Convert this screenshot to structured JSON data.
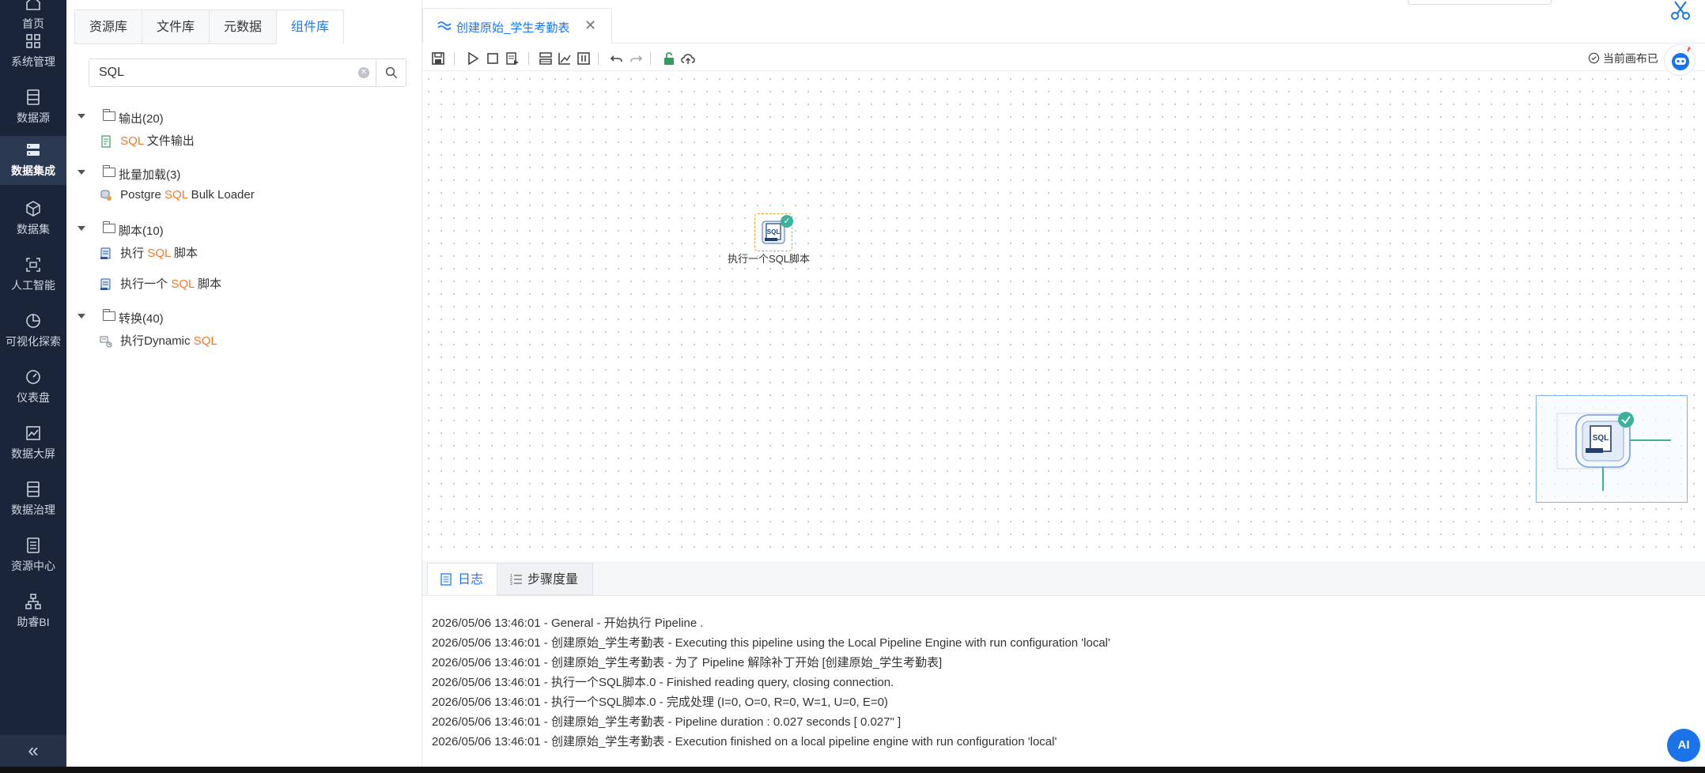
{
  "nav": {
    "items": [
      {
        "label": "首页",
        "icon": "home-icon"
      },
      {
        "label": "系统管理",
        "icon": "grid-icon"
      },
      {
        "label": "数据源",
        "icon": "database-icon"
      },
      {
        "label": "数据集成",
        "icon": "server-stack-icon"
      },
      {
        "label": "数据集",
        "icon": "cube-icon"
      },
      {
        "label": "人工智能",
        "icon": "ai-scan-icon"
      },
      {
        "label": "可视化探索",
        "icon": "pie-icon"
      },
      {
        "label": "仪表盘",
        "icon": "gauge-icon"
      },
      {
        "label": "数据大屏",
        "icon": "line-chart-icon"
      },
      {
        "label": "数据治理",
        "icon": "list-box-icon"
      },
      {
        "label": "资源中心",
        "icon": "book-icon"
      },
      {
        "label": "助睿BI",
        "icon": "org-tree-icon"
      }
    ],
    "active_index": 3,
    "collapse_glyph": "«"
  },
  "panel": {
    "tabs": [
      "资源库",
      "文件库",
      "元数据",
      "组件库"
    ],
    "active_tab": 3,
    "search": {
      "value": "SQL"
    },
    "tree": {
      "group1": {
        "label": "输出(20)"
      },
      "leaf1": {
        "pre": "",
        "hl": "SQL",
        "post": " 文件输出"
      },
      "group2": {
        "label": "批量加载(3)"
      },
      "leaf2": {
        "pre": "Postgre ",
        "hl": "SQL",
        "post": " Bulk Loader"
      },
      "group3": {
        "label": "脚本(10)"
      },
      "leaf3": {
        "pre": "执行 ",
        "hl": "SQL",
        "post": " 脚本"
      },
      "leaf4": {
        "pre": "执行一个 ",
        "hl": "SQL",
        "post": " 脚本"
      },
      "group4": {
        "label": "转换(40)"
      },
      "leaf5": {
        "pre": "执行Dynamic ",
        "hl": "SQL",
        "post": ""
      }
    }
  },
  "doc": {
    "tab_title": "创建原始_学生考勤表",
    "close_glyph": "✕"
  },
  "toolbar": {
    "right_label": "当前画布已"
  },
  "canvas": {
    "step_label": "执行一个SQL脚本",
    "step_icon_text": "SQL",
    "minimap_icon_text": "SQL"
  },
  "log": {
    "tabs": [
      "日志",
      "步骤度量"
    ],
    "lines": [
      "2026/05/06 13:46:01 - General - 开始执行 Pipeline .",
      "2026/05/06 13:46:01 - 创建原始_学生考勤表 - Executing this pipeline using the Local Pipeline Engine with run configuration 'local'",
      "2026/05/06 13:46:01 - 创建原始_学生考勤表 - 为了 Pipeline 解除补丁开始 [创建原始_学生考勤表]",
      "2026/05/06 13:46:01 - 执行一个SQL脚本.0 - Finished reading query, closing connection.",
      "2026/05/06 13:46:01 - 执行一个SQL脚本.0 - 完成处理 (I=0, O=0, R=0, W=1, U=0, E=0)",
      "2026/05/06 13:46:01 - 创建原始_学生考勤表 - Pipeline duration : 0.027 seconds [  0.027\" ]",
      "2026/05/06 13:46:01 - 创建原始_学生考勤表 - Execution finished on a local pipeline engine with run configuration 'local'"
    ]
  },
  "floating": {
    "ai_label": "AI"
  },
  "colors": {
    "nav_bg": "#1b2539",
    "accent": "#1677ff",
    "highlight": "#f07a28",
    "ok": "#3bb39b"
  }
}
